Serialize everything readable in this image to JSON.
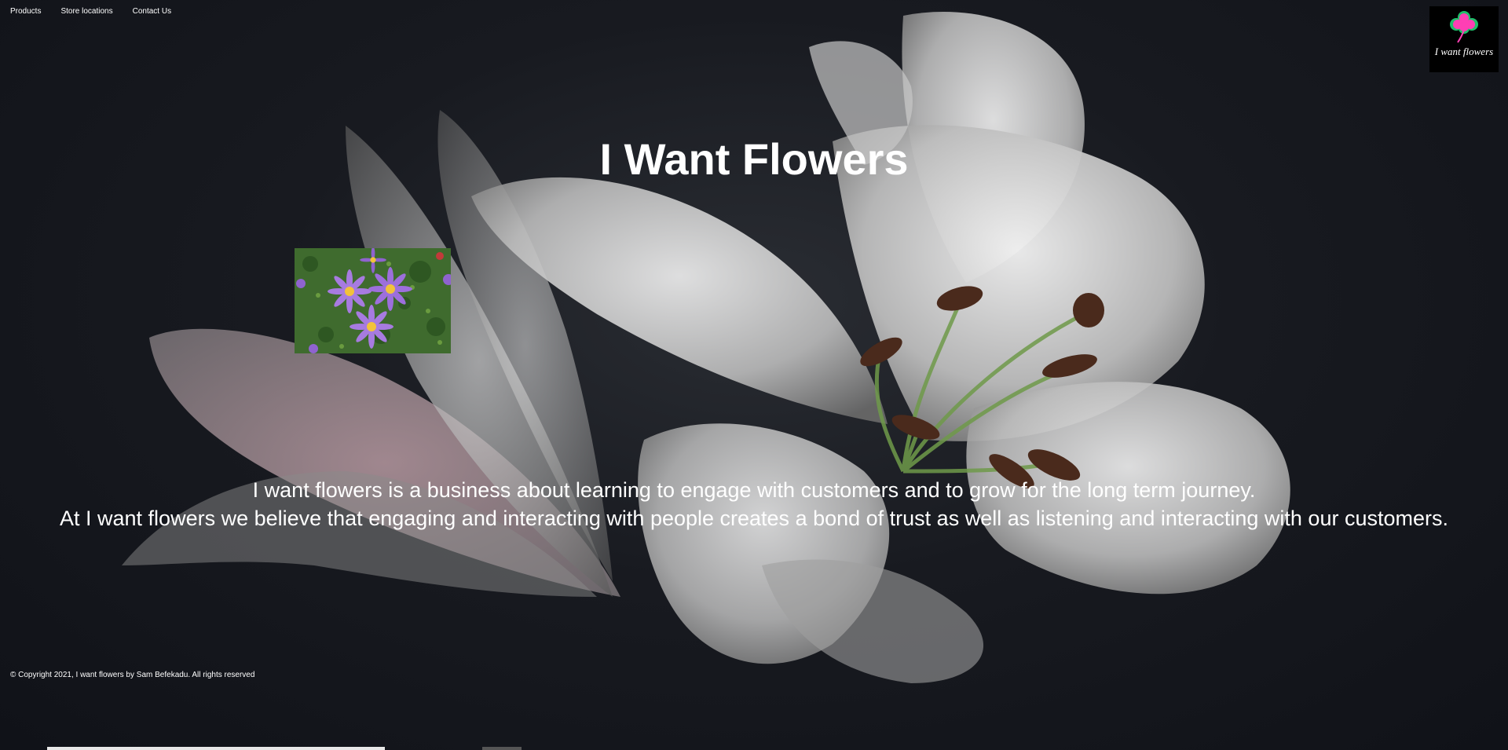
{
  "nav": {
    "items": [
      {
        "label": "Products"
      },
      {
        "label": "Store locations"
      },
      {
        "label": "Contact Us"
      }
    ]
  },
  "logo": {
    "text": "I want flowers",
    "icon": "clover-flower-icon"
  },
  "hero": {
    "title": "I Want Flowers"
  },
  "description": {
    "line1": "I want flowers is a business about learning to engage with customers and to grow for the long term journey.",
    "line2": "At I want flowers we believe that engaging and interacting with people creates a bond of trust as well as listening and interacting with our customers."
  },
  "footer": {
    "copyright": "© Copyright 2021, I want flowers by Sam Befekadu. All rights reserved"
  },
  "colors": {
    "background": "#12141a",
    "text": "#ffffff",
    "logo_flower": "#ff3fb4",
    "logo_leaf": "#1fbf6a"
  }
}
